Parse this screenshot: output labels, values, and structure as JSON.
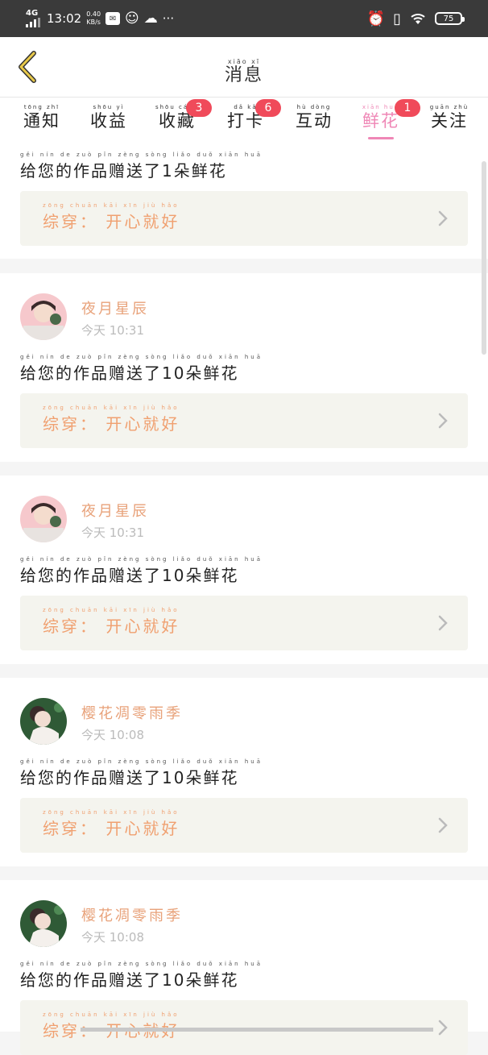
{
  "status": {
    "network": "4G",
    "time": "13:02",
    "speed_value": "0.40",
    "speed_unit": "KB/s",
    "more": "···",
    "battery": "75"
  },
  "nav": {
    "title": "消息",
    "title_pinyin": "xiāo xī"
  },
  "tabs": [
    {
      "label": "通知",
      "pinyin": "tōng zhī",
      "badge": ""
    },
    {
      "label": "收益",
      "pinyin": "shōu yì",
      "badge": ""
    },
    {
      "label": "收藏",
      "pinyin": "shōu cáng",
      "badge": "3"
    },
    {
      "label": "打卡",
      "pinyin": "dǎ kǎ",
      "badge": "6"
    },
    {
      "label": "互动",
      "pinyin": "hù dòng",
      "badge": ""
    },
    {
      "label": "鲜花",
      "pinyin": "xiān huā",
      "badge": "1"
    },
    {
      "label": "关注",
      "pinyin": "guān zhù",
      "badge": ""
    }
  ],
  "messages": [
    {
      "user": "",
      "time": "",
      "text": "给您的作品赠送了1朵鲜花",
      "text_pinyin": "gěi nín de zuò pǐn zèng sòng liǎo duǒ xiān huā",
      "work_title": "综穿： 开心就好",
      "work_pinyin": "zōng chuān  kāi xīn jiù hǎo"
    },
    {
      "user": "夜月星辰",
      "time": "今天 10:31",
      "text": "给您的作品赠送了10朵鲜花",
      "text_pinyin": "gěi nín de zuò pǐn zèng sòng liǎo duǒ xiān huā",
      "work_title": "综穿： 开心就好",
      "work_pinyin": "zōng chuān  kāi xīn jiù hǎo"
    },
    {
      "user": "夜月星辰",
      "time": "今天 10:31",
      "text": "给您的作品赠送了10朵鲜花",
      "text_pinyin": "gěi nín de zuò pǐn zèng sòng liǎo duǒ xiān huā",
      "work_title": "综穿： 开心就好",
      "work_pinyin": "zōng chuān  kāi xīn jiù hǎo"
    },
    {
      "user": "樱花凋零雨季",
      "time": "今天 10:08",
      "text": "给您的作品赠送了10朵鲜花",
      "text_pinyin": "gěi nín de zuò pǐn zèng sòng liǎo duǒ xiān huā",
      "work_title": "综穿： 开心就好",
      "work_pinyin": "zōng chuān  kāi xīn jiù hǎo"
    },
    {
      "user": "樱花凋零雨季",
      "time": "今天 10:08",
      "text": "给您的作品赠送了10朵鲜花",
      "text_pinyin": "gěi nín de zuò pǐn zèng sòng liǎo duǒ xiān huā",
      "work_title": "综穿： 开心就好",
      "work_pinyin": "zōng chuān  kāi xīn jiù hǎo"
    }
  ],
  "colors": {
    "accent": "#ef87b6",
    "badge": "#f04a5a",
    "username": "#e8a27a",
    "work_title": "#f0a070",
    "back_arrow": "#e8c94a"
  }
}
